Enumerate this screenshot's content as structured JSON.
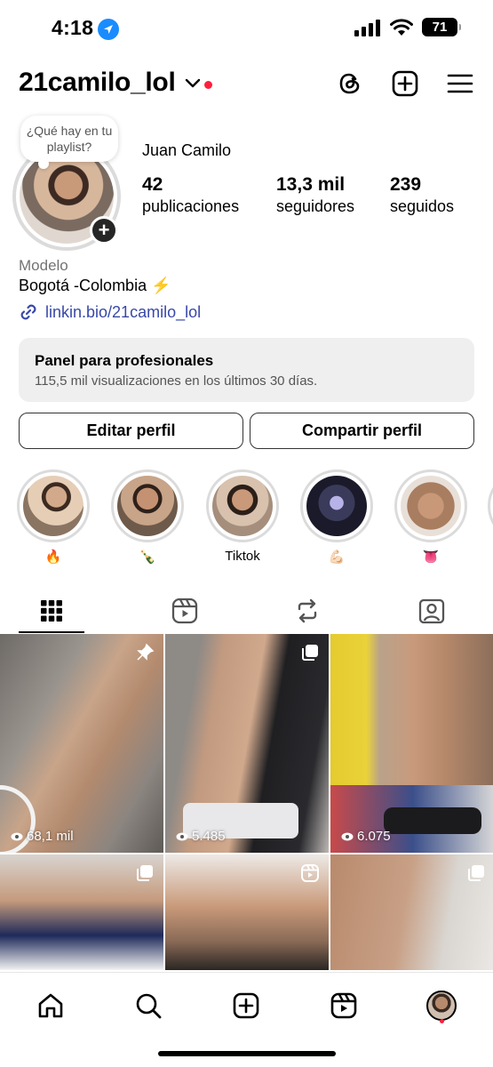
{
  "status_bar": {
    "time": "4:18",
    "battery": "71"
  },
  "header": {
    "username": "21camilo_lol"
  },
  "profile": {
    "note": "¿Qué hay en tu playlist?",
    "full_name": "Juan Camilo",
    "stats": [
      {
        "value": "42",
        "label": "publicaciones"
      },
      {
        "value": "13,3 mil",
        "label": "seguidores"
      },
      {
        "value": "239",
        "label": "seguidos"
      }
    ],
    "category": "Modelo",
    "bio": "Bogotá -Colombia ⚡️",
    "link": "linkin.bio/21camilo_lol"
  },
  "pro_panel": {
    "title": "Panel para profesionales",
    "subtitle": "115,5 mil visualizaciones en los últimos 30 días."
  },
  "buttons": {
    "edit": "Editar perfil",
    "share": "Compartir perfil"
  },
  "highlights": [
    {
      "label": "🔥"
    },
    {
      "label": "🍾"
    },
    {
      "label": "Tiktok"
    },
    {
      "label": "💪🏻"
    },
    {
      "label": "👅"
    }
  ],
  "tabs": [
    "grid",
    "reels",
    "reposts",
    "tagged"
  ],
  "posts": [
    {
      "views": "68,1 mil",
      "badge": "pin"
    },
    {
      "views": "5.485",
      "badge": "carousel"
    },
    {
      "views": "6.075",
      "badge": "none"
    },
    {
      "views": "",
      "badge": "carousel"
    },
    {
      "views": "",
      "badge": "reel"
    },
    {
      "views": "",
      "badge": "carousel"
    }
  ],
  "colors": {
    "link": "#3848a8",
    "notification": "#ff1f3d",
    "location": "#1a8cff"
  }
}
